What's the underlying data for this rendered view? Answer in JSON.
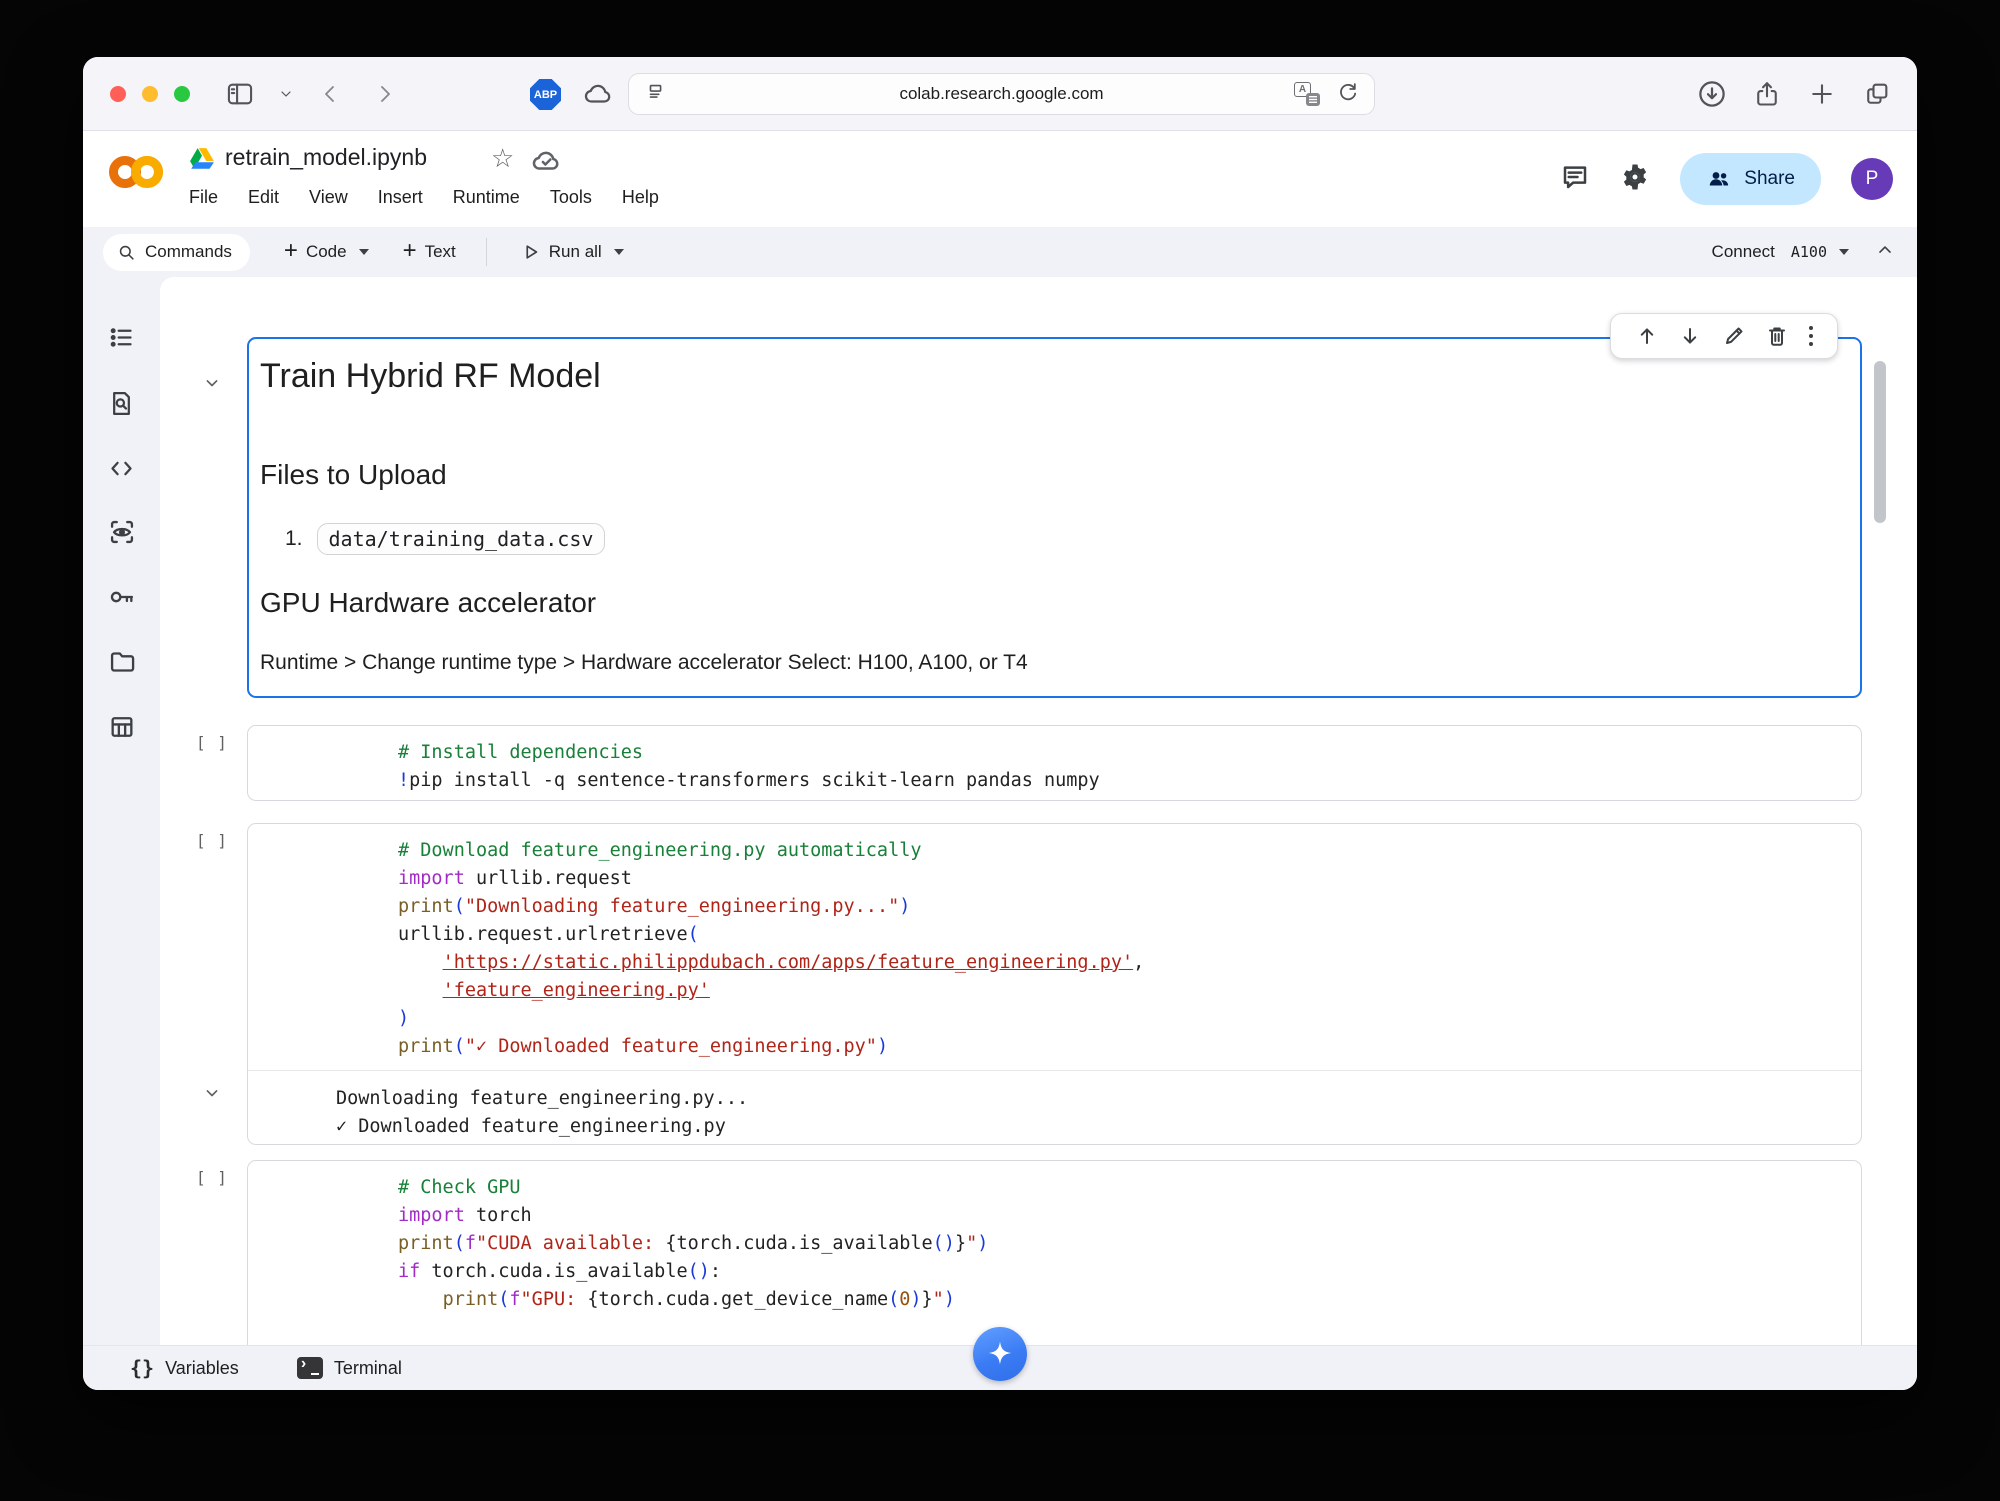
{
  "browser": {
    "url": "colab.research.google.com",
    "adblock_badge": "ABP"
  },
  "header": {
    "title": "retrain_model.ipynb",
    "menus": [
      "File",
      "Edit",
      "View",
      "Insert",
      "Runtime",
      "Tools",
      "Help"
    ],
    "share_label": "Share",
    "avatar_initial": "P"
  },
  "toolbar": {
    "commands_label": "Commands",
    "code_label": "Code",
    "text_label": "Text",
    "run_all_label": "Run all",
    "connect_label": "Connect",
    "accelerator": "A100"
  },
  "markdown_cell": {
    "h1": "Train Hybrid RF Model",
    "h2_files": "Files to Upload",
    "list_number": "1.",
    "file_chip": "data/training_data.csv",
    "h2_gpu": "GPU Hardware accelerator",
    "runtime_note": "Runtime > Change runtime type > Hardware accelerator Select: H100, A100, or T4"
  },
  "cells": {
    "gutter": "[ ]",
    "install": {
      "lines": [
        [
          [
            "cm",
            "# Install dependencies"
          ]
        ],
        [
          [
            "pn",
            "!"
          ],
          [
            "pl",
            "pip install -q sentence-transformers scikit-learn pandas numpy"
          ]
        ]
      ]
    },
    "download": {
      "lines": [
        [
          [
            "cm",
            "# Download feature_engineering.py automatically"
          ]
        ],
        [
          [
            "kw",
            "import"
          ],
          [
            "pl",
            " urllib.request"
          ]
        ],
        [
          [
            "bi",
            "print"
          ],
          [
            "pn",
            "("
          ],
          [
            "st",
            "\"Downloading feature_engineering.py...\""
          ],
          [
            "pn",
            ")"
          ]
        ],
        [
          [
            "pl",
            "urllib.request.urlretrieve"
          ],
          [
            "pn",
            "("
          ]
        ],
        [
          [
            "pl",
            "    "
          ],
          [
            "ln",
            "'https://static.philippdubach.com/apps/feature_engineering.py'"
          ],
          [
            "pl",
            ","
          ]
        ],
        [
          [
            "pl",
            "    "
          ],
          [
            "ln",
            "'feature_engineering.py'"
          ]
        ],
        [
          [
            "pn",
            ")"
          ]
        ],
        [
          [
            "bi",
            "print"
          ],
          [
            "pn",
            "("
          ],
          [
            "st",
            "\"✓ Downloaded feature_engineering.py\""
          ],
          [
            "pn",
            ")"
          ]
        ]
      ],
      "output": [
        "Downloading feature_engineering.py...",
        "✓ Downloaded feature_engineering.py"
      ]
    },
    "gpu": {
      "lines": [
        [
          [
            "cm",
            "# Check GPU"
          ]
        ],
        [
          [
            "kw",
            "import"
          ],
          [
            "pl",
            " torch"
          ]
        ],
        [
          [
            "bi",
            "print"
          ],
          [
            "pn",
            "("
          ],
          [
            "kw",
            "f"
          ],
          [
            "st",
            "\"CUDA available: "
          ],
          [
            "pl",
            "{"
          ],
          [
            "pl",
            "torch.cuda.is_available"
          ],
          [
            "pn",
            "()"
          ],
          [
            "pl",
            "}"
          ],
          [
            "st",
            "\""
          ],
          [
            "pn",
            ")"
          ]
        ],
        [
          [
            "kw",
            "if"
          ],
          [
            "pl",
            " torch.cuda.is_available"
          ],
          [
            "pn",
            "()"
          ],
          [
            "pl",
            ":"
          ]
        ],
        [
          [
            "pl",
            "    "
          ],
          [
            "bi",
            "print"
          ],
          [
            "pn",
            "("
          ],
          [
            "kw",
            "f"
          ],
          [
            "st",
            "\"GPU: "
          ],
          [
            "pl",
            "{"
          ],
          [
            "pl",
            "torch.cuda.get_device_name"
          ],
          [
            "pn",
            "("
          ],
          [
            "nu",
            "0"
          ],
          [
            "pn",
            ")"
          ],
          [
            "pl",
            "}"
          ],
          [
            "st",
            "\""
          ],
          [
            "pn",
            ")"
          ]
        ]
      ]
    }
  },
  "bottom_bar": {
    "variables_label": "Variables",
    "terminal_label": "Terminal"
  },
  "colors": {
    "selected_cell_border": "#1a73e8",
    "share_button_bg": "#c2e7ff",
    "avatar_bg": "#673ab7",
    "code_comment": "#188038",
    "code_keyword": "#a12bc4",
    "code_builtin": "#795e26",
    "code_string": "#b02418",
    "code_paren": "#1a39d8",
    "gemini_fab": "#3b7cf5"
  }
}
